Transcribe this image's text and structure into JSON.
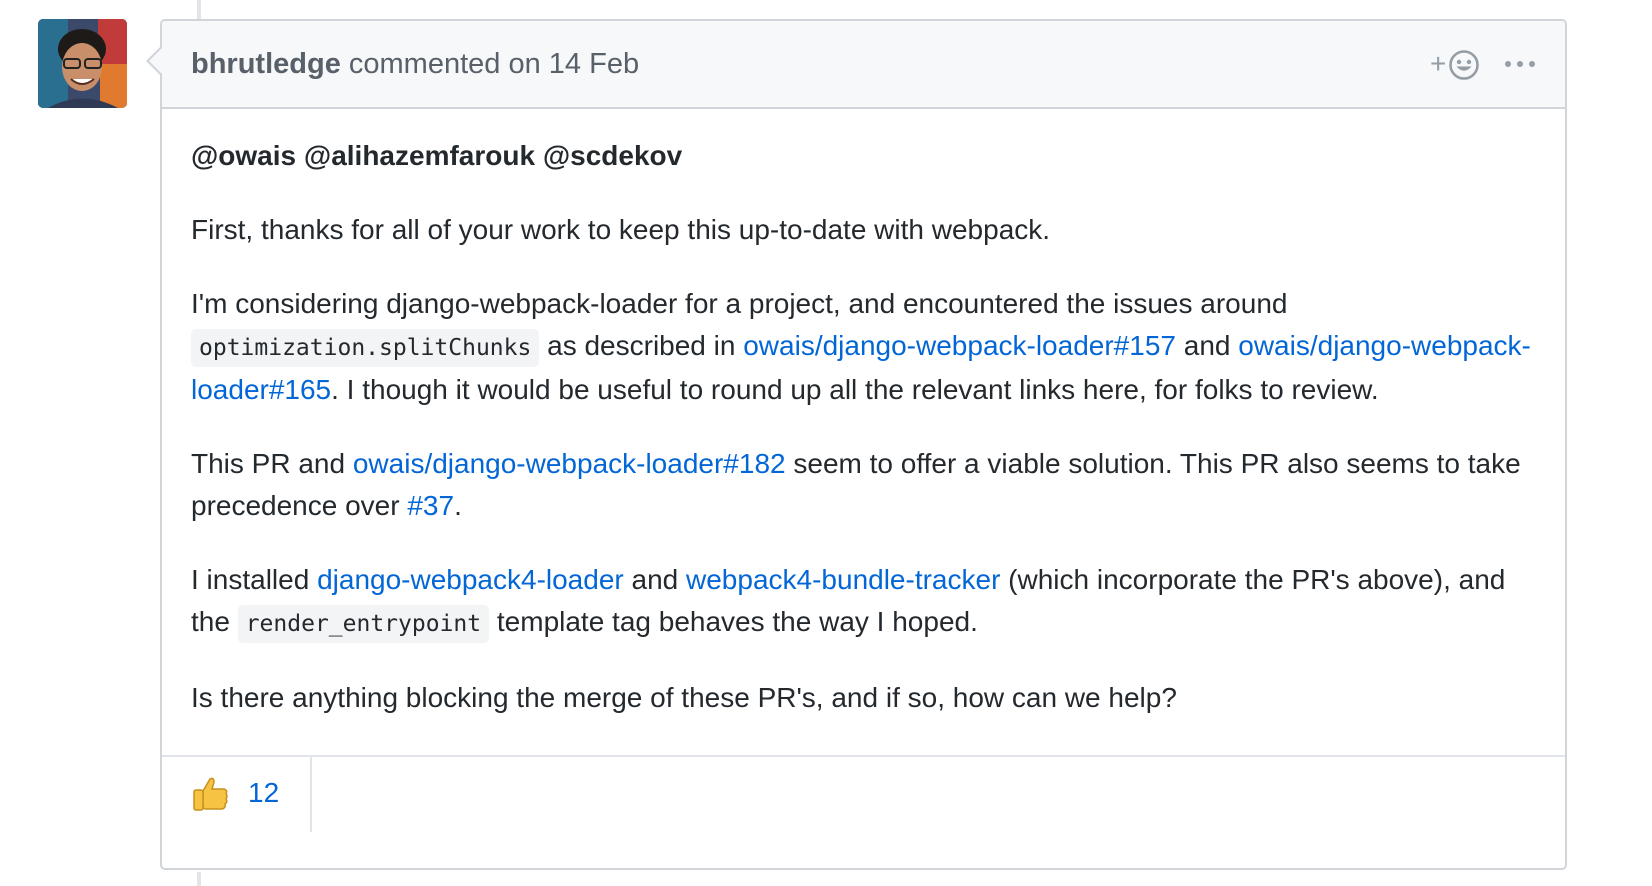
{
  "comment": {
    "author": "bhrutledge",
    "action_text": " commented on 14 Feb",
    "header_icons": [
      "add-reaction-icon",
      "kebab-horizontal-icon"
    ],
    "add_reaction_plus": "+",
    "mentions": [
      "@owais",
      "@alihazemfarouk",
      "@scdekov"
    ],
    "p1": "First, thanks for all of your work to keep this up-to-date with webpack.",
    "p2": {
      "t1": "I'm considering django-webpack-loader for a project, and encountered the issues around",
      "code1": "optimization.splitChunks",
      "t2": " as described in ",
      "link1": "owais/django-webpack-loader#157",
      "t3": " and ",
      "link2": "owais/django-webpack-loader#165",
      "t4": ". I though it would be useful to round up all the relevant links here, for folks to review."
    },
    "p3": {
      "t1": "This PR and ",
      "link1": "owais/django-webpack-loader#182",
      "t2": " seem to offer a viable solution. This PR also seems to take precedence over ",
      "link2": "#37",
      "t3": "."
    },
    "p4": {
      "t1": "I installed ",
      "link1": "django-webpack4-loader",
      "t2": " and ",
      "link2": "webpack4-bundle-tracker",
      "t3": " (which incorporate the PR's above), and the ",
      "code1": "render_entrypoint",
      "t4": " template tag behaves the way I hoped."
    },
    "p5": "Is there anything blocking the merge of these PR's, and if so, how can we help?",
    "reactions": [
      {
        "icon": "thumbs-up-icon",
        "count": "12"
      }
    ]
  },
  "colors": {
    "link": "#0366d6",
    "header_bg": "#f6f8fa",
    "border": "#d1d5da",
    "text": "#24292e",
    "muted": "#586069"
  }
}
